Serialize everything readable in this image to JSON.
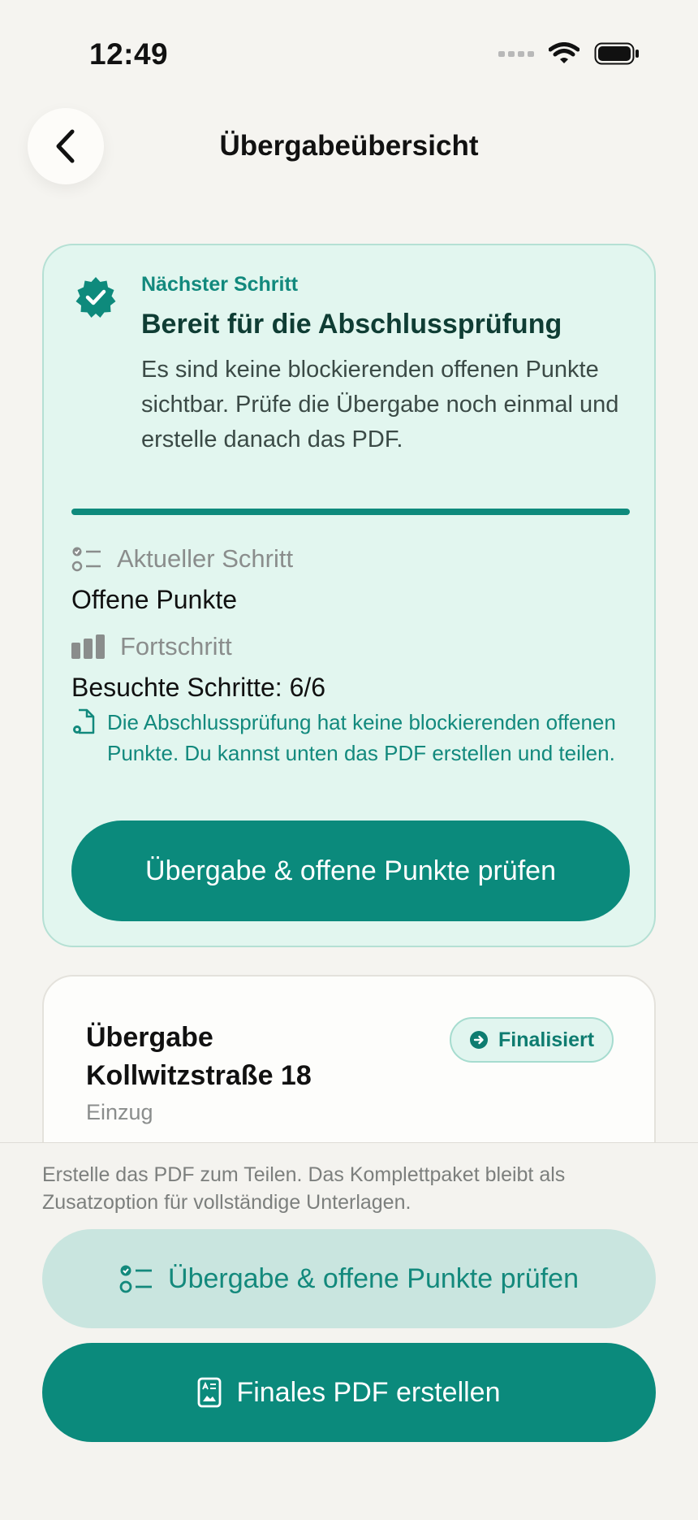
{
  "status_bar": {
    "time": "12:49"
  },
  "nav": {
    "title": "Übergabeübersicht"
  },
  "step_card": {
    "kicker": "Nächster Schritt",
    "title": "Bereit für die Abschlussprüfung",
    "description": "Es sind keine blockierenden offenen Punkte sichtbar. Prüfe die Übergabe noch einmal und erstelle danach das PDF.",
    "current_step_label": "Aktueller Schritt",
    "current_step_value": "Offene Punkte",
    "progress_label": "Fortschritt",
    "progress_value": "Besuchte Schritte: 6/6",
    "note": "Die Abschlussprüfung hat keine blockierenden offenen Punkte. Du kannst unten das PDF erstellen und teilen.",
    "button_label": "Übergabe & offene Punkte prüfen"
  },
  "handover_card": {
    "title": "Übergabe Kollwitzstraße 18",
    "subtitle": "Einzug",
    "status": "Finalisiert"
  },
  "bottom_sheet": {
    "hint": "Erstelle das PDF zum Teilen. Das Komplettpaket bleibt als Zusatzoption für vollständige Unterlagen.",
    "secondary_button": "Übergabe & offene Punkte prüfen",
    "primary_button": "Finales PDF erstellen"
  },
  "colors": {
    "accent": "#0b8a7c",
    "accent_light": "#e2f6ef",
    "background": "#f5f4f0"
  },
  "icons": [
    "chevron-left-icon",
    "seal-check-icon",
    "checklist-icon",
    "bar-chart-icon",
    "document-gear-icon",
    "arrow-circle-icon",
    "pdf-document-icon",
    "wifi-icon",
    "battery-icon",
    "signal-icon"
  ]
}
